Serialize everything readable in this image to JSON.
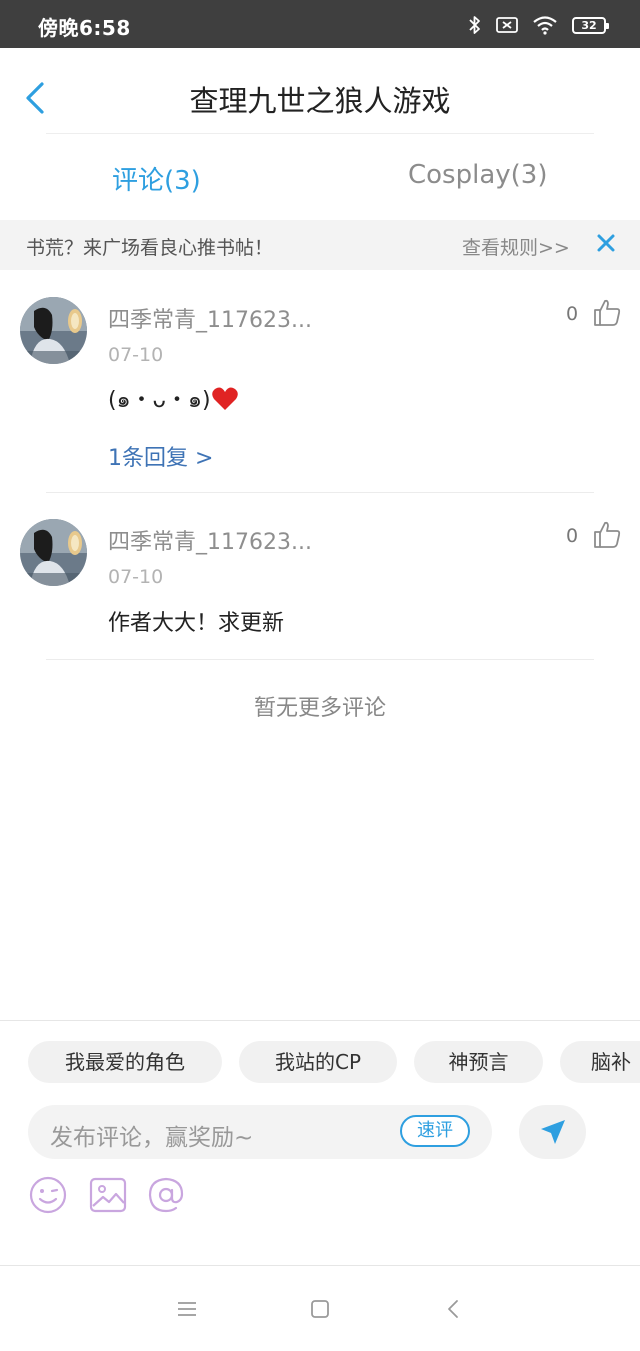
{
  "status_bar": {
    "time": "傍晚6:58",
    "battery": "32"
  },
  "header": {
    "title": "查理九世之狼人游戏"
  },
  "tabs": [
    {
      "label": "评论(3)",
      "active": true
    },
    {
      "label": "Cosplay(3)",
      "active": false
    }
  ],
  "banner": {
    "text": "书荒？来广场看良心推书帖！",
    "link": "查看规则>>"
  },
  "comments": [
    {
      "user": "四季常青_117623...",
      "date": "07-10",
      "text": "(๑・ᴗ・๑)",
      "likes": "0",
      "replies": "1条回复 >"
    },
    {
      "user": "四季常青_117623...",
      "date": "07-10",
      "text": "作者大大！求更新",
      "likes": "0"
    }
  ],
  "end_text": "暂无更多评论",
  "quick_tags": [
    "我最爱的角色",
    "我站的CP",
    "神预言",
    "脑补"
  ],
  "composer": {
    "placeholder": "发布评论，赢奖励~",
    "quick_label": "速评"
  },
  "colors": {
    "accent": "#2e9fe0",
    "reply_link": "#3e73b5",
    "tool_icons": "#c9a6df"
  }
}
